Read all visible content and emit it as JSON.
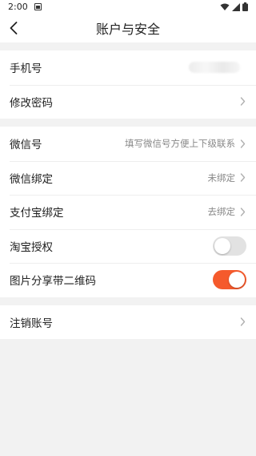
{
  "status_bar": {
    "time": "2:00"
  },
  "header": {
    "title": "账户与安全"
  },
  "section1": {
    "phone_label": "手机号",
    "password_label": "修改密码"
  },
  "section2": {
    "wechat_id_label": "微信号",
    "wechat_id_value": "填写微信号方便上下级联系",
    "wechat_bind_label": "微信绑定",
    "wechat_bind_value": "未绑定",
    "alipay_bind_label": "支付宝绑定",
    "alipay_bind_value": "去绑定",
    "taobao_auth_label": "淘宝授权",
    "taobao_auth_enabled": false,
    "share_qr_label": "图片分享带二维码",
    "share_qr_enabled": true
  },
  "section3": {
    "cancel_account_label": "注销账号"
  },
  "colors": {
    "accent": "#f55a2c",
    "toggle_off": "#e2e2e2"
  }
}
